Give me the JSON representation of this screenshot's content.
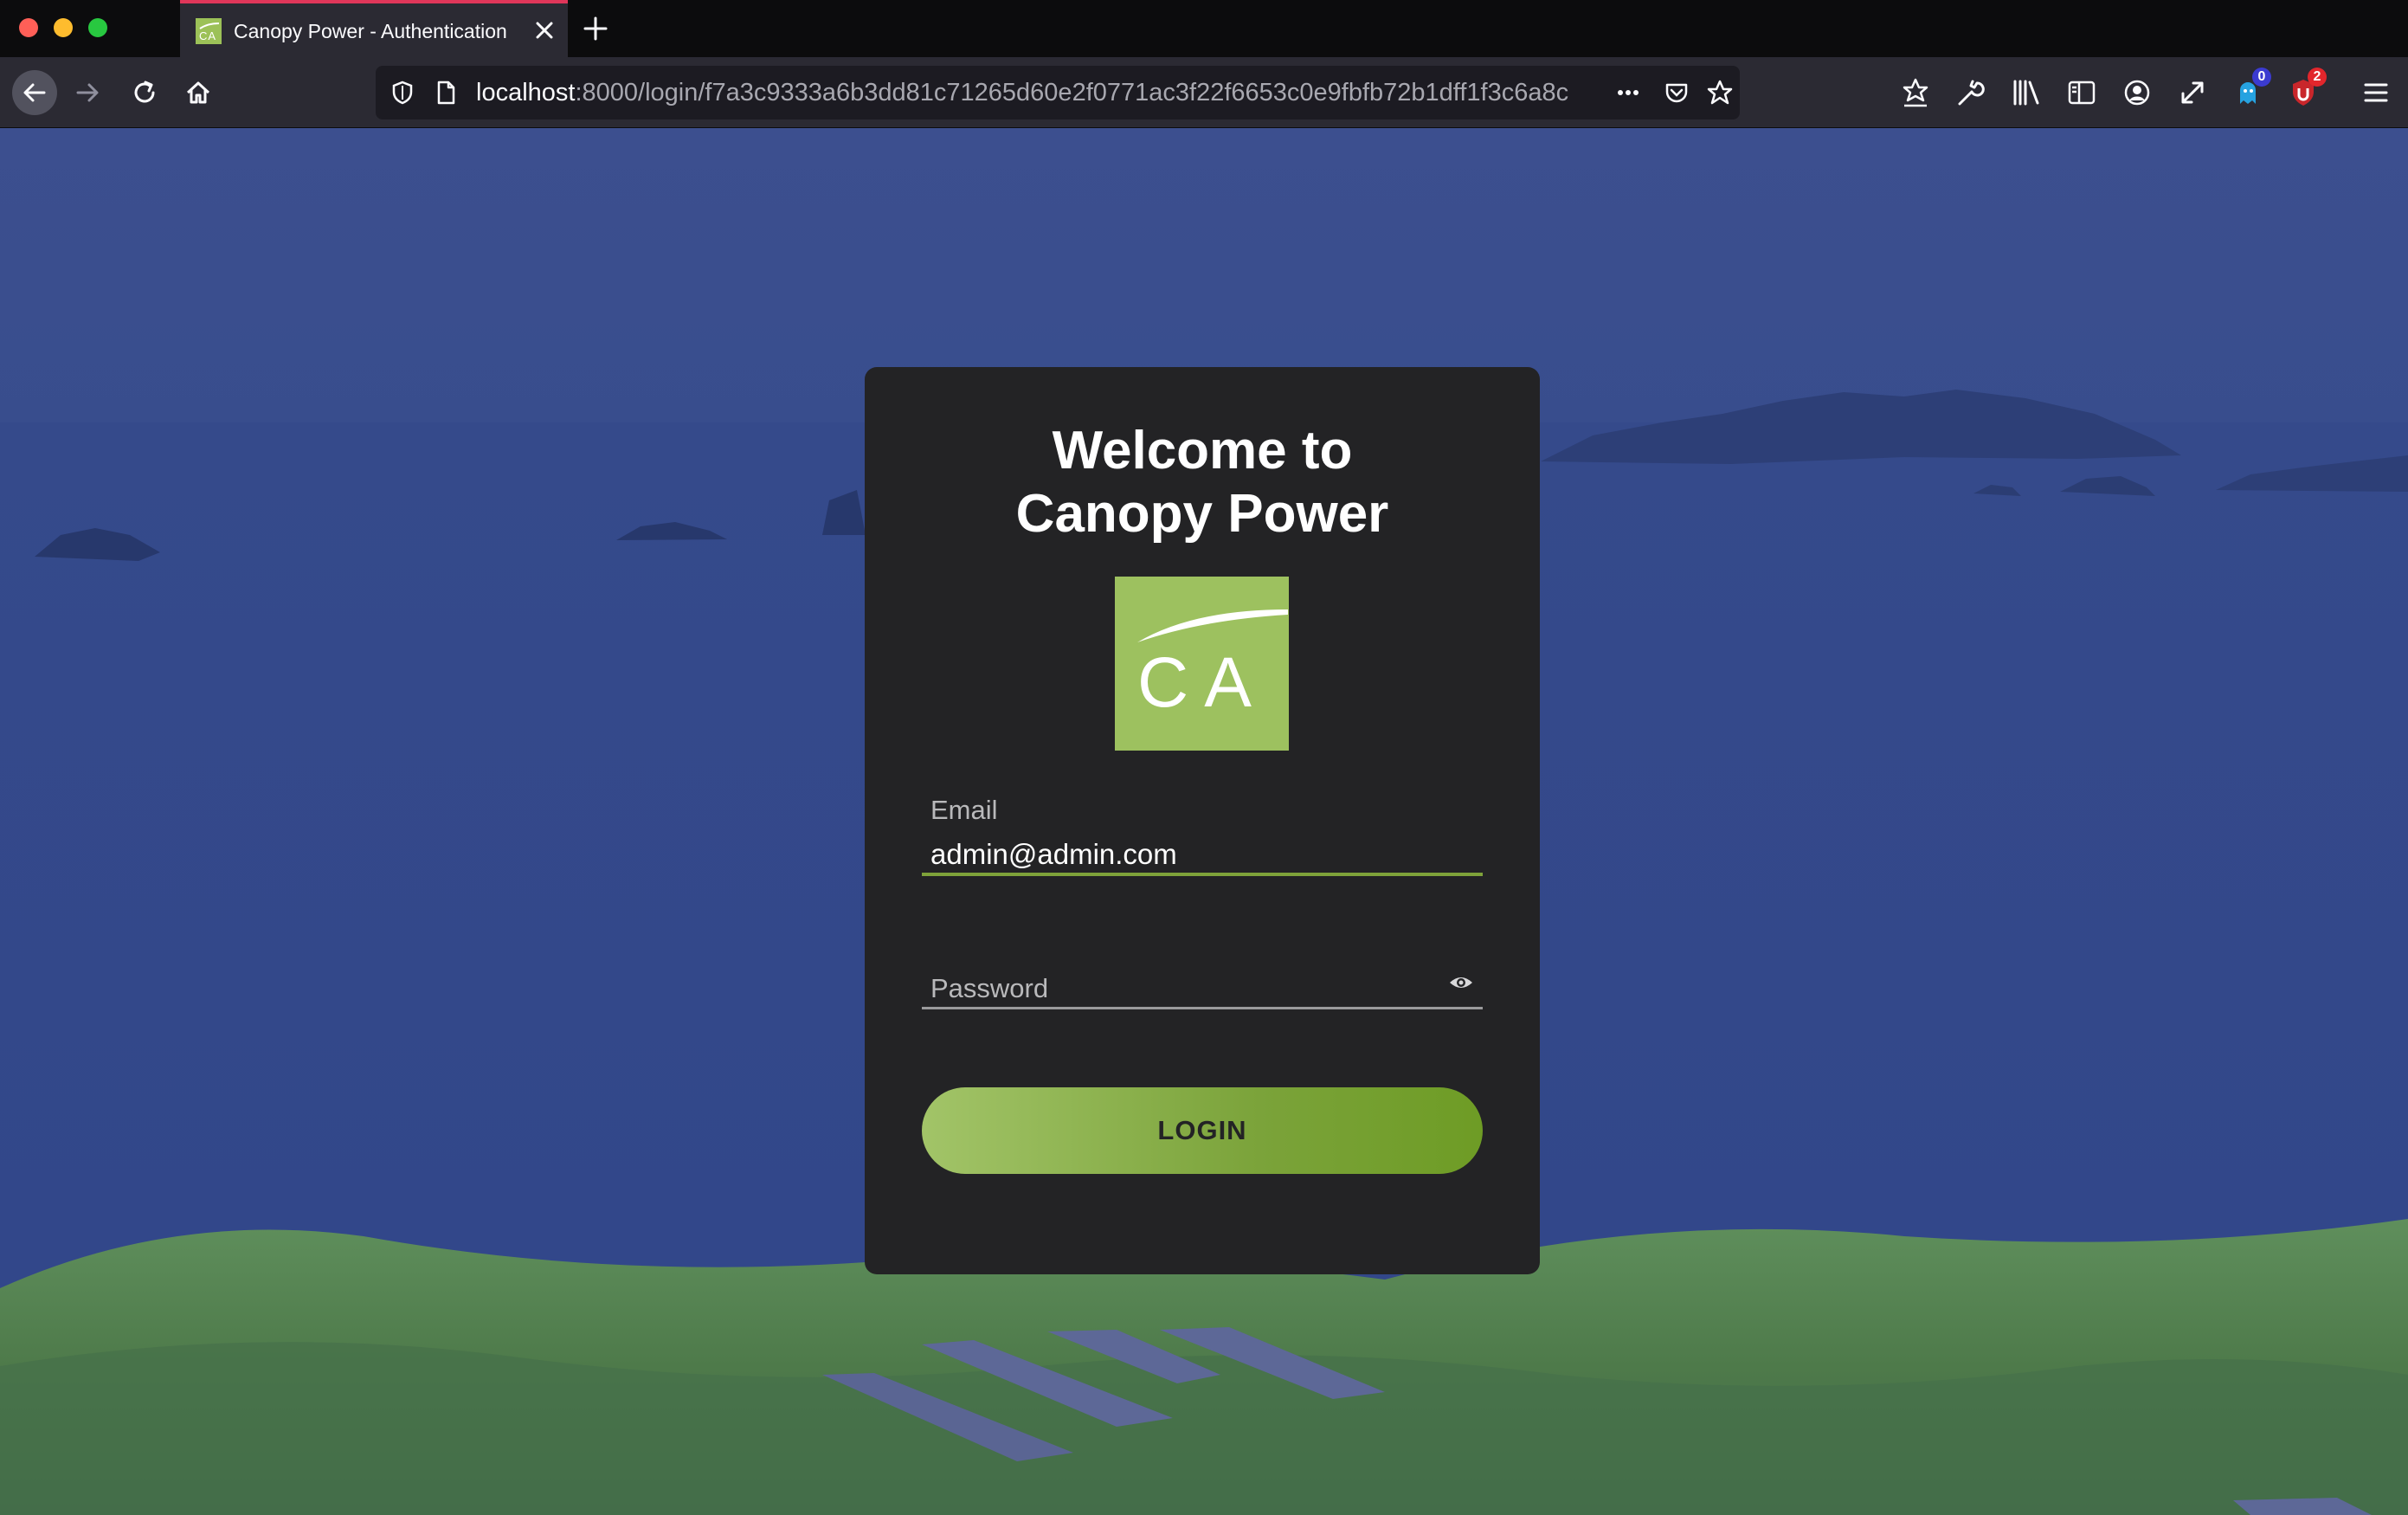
{
  "browser": {
    "tab_title": "Canopy Power - Authentication",
    "url_host": "localhost",
    "url_rest": ":8000/login/f7a3c9333a6b3dd81c71265d60e2f0771ac3f22f6653c0e9fbfb72b1dff1f3c6a8c",
    "extension_badges": {
      "ghostery_count": "0",
      "ublock_count": "2"
    },
    "colors": {
      "tab_accent": "#e0365a",
      "badge_blue": "#3b3bd0",
      "badge_red": "#e2262c"
    }
  },
  "login": {
    "welcome_line1": "Welcome to",
    "welcome_line2": "Canopy Power",
    "logo_text": "CA",
    "email_label": "Email",
    "email_value": "admin@admin.com",
    "password_label": "Password",
    "login_label": "LOGIN",
    "colors": {
      "brand_green": "#9dc15f",
      "card_bg": "#232325",
      "email_underline": "#7ea23a"
    }
  }
}
